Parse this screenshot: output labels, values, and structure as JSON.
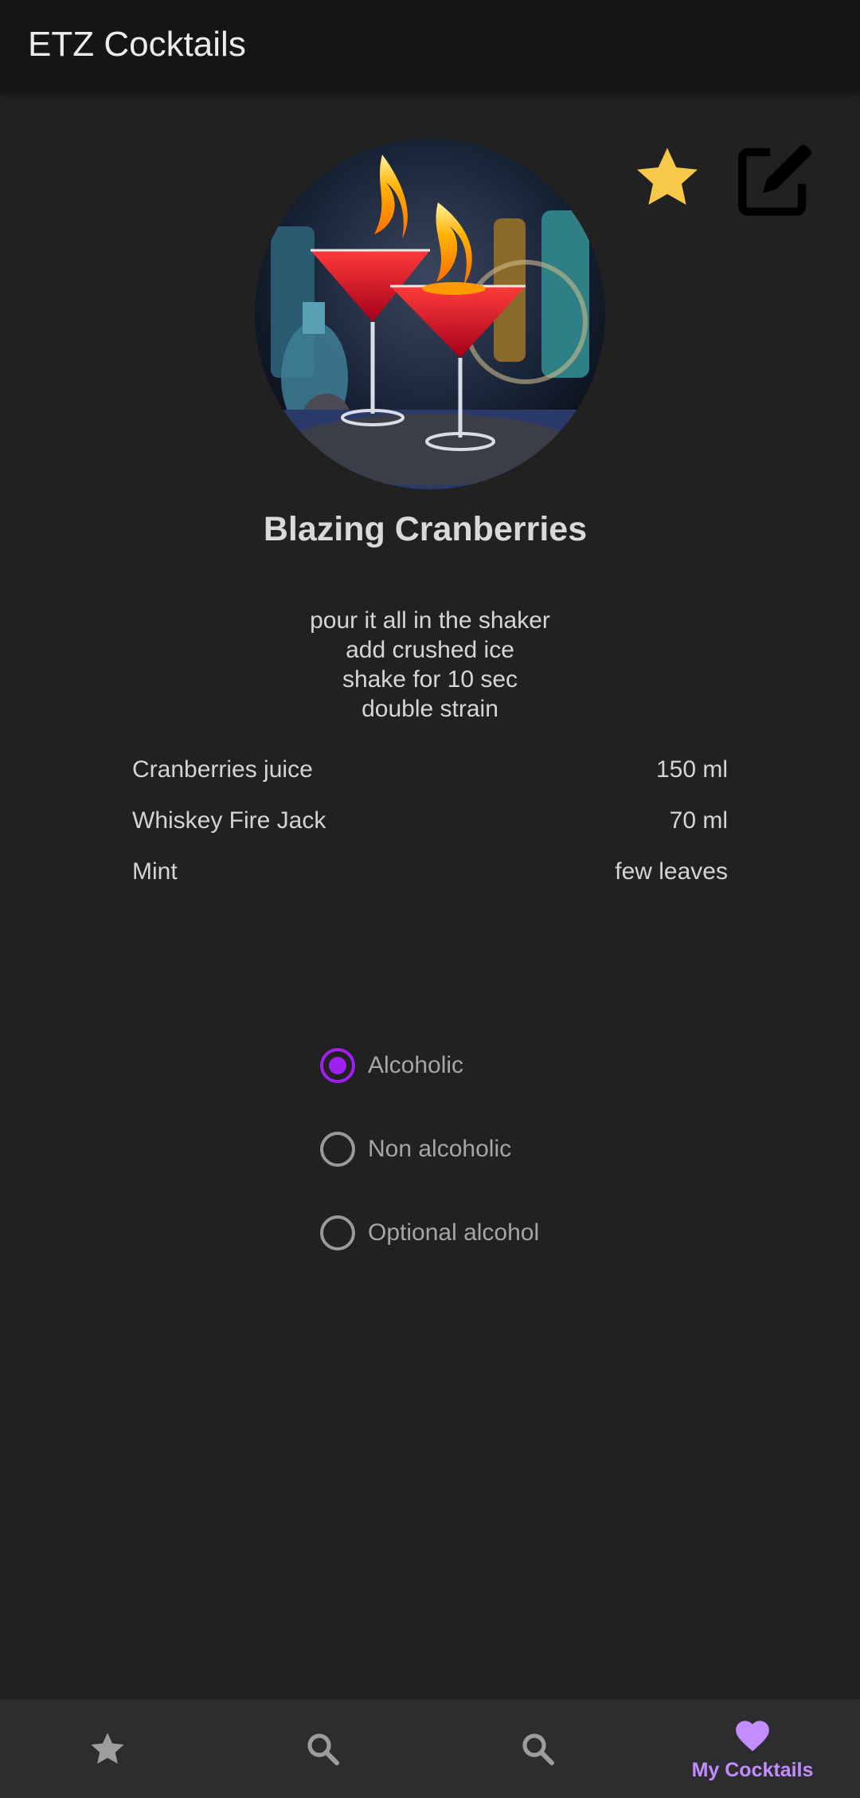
{
  "app_bar": {
    "title": "ETZ Cocktails"
  },
  "actions": {
    "favorite_icon": "star-icon",
    "favorite_color": "#f7c948",
    "edit_icon": "edit-square-icon"
  },
  "cocktail": {
    "name": "Blazing Cranberries",
    "instructions": [
      "pour it all in the shaker",
      "add crushed ice",
      "shake for 10 sec",
      "double strain"
    ],
    "ingredients": [
      {
        "name": "Cranberries juice",
        "amount": "150 ml"
      },
      {
        "name": "Whiskey Fire Jack",
        "amount": "70 ml"
      },
      {
        "name": "Mint",
        "amount": "few leaves"
      }
    ]
  },
  "alcohol_type": {
    "options": [
      "Alcoholic",
      "Non alcoholic",
      "Optional alcohol"
    ],
    "selected": "Alcoholic",
    "accent": "#a020f0"
  },
  "bottom_nav": {
    "items": [
      {
        "icon": "star-icon",
        "label": ""
      },
      {
        "icon": "search-icon",
        "label": ""
      },
      {
        "icon": "search-icon",
        "label": ""
      },
      {
        "icon": "heart-icon",
        "label": "My Cocktails",
        "active": true
      }
    ],
    "active_color": "#c38cff"
  }
}
